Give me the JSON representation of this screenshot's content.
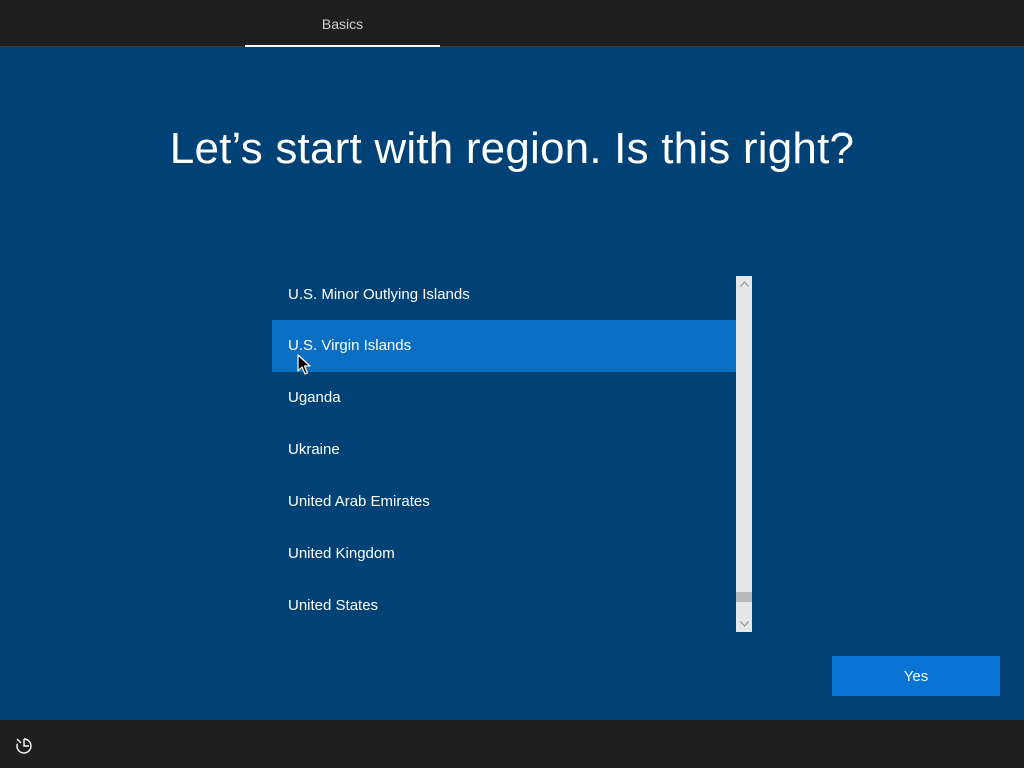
{
  "header": {
    "tabs": [
      {
        "label": "Basics",
        "active": true
      }
    ]
  },
  "main": {
    "title": "Let’s start with region. Is this right?",
    "regions": {
      "selected_index": 1,
      "items": [
        "U.S. Minor Outlying Islands",
        "U.S. Virgin Islands",
        "Uganda",
        "Ukraine",
        "United Arab Emirates",
        "United Kingdom",
        "United States"
      ]
    },
    "yes_label": "Yes"
  },
  "footer": {
    "accessibility_icon": "ease-of-access-icon"
  },
  "colors": {
    "background": "#004275",
    "bars": "#1f1f1f",
    "selected": "#0a6fc2",
    "button": "#0a74d4"
  }
}
